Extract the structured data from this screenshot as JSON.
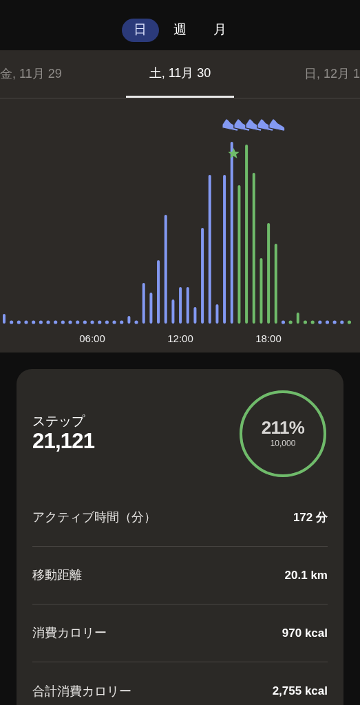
{
  "period_tabs": [
    {
      "label": "日",
      "selected": true
    },
    {
      "label": "週",
      "selected": false
    },
    {
      "label": "月",
      "selected": false
    }
  ],
  "date_tabs": [
    {
      "label": "金, 11月 29",
      "selected": false
    },
    {
      "label": "土, 11月 30",
      "selected": true
    },
    {
      "label": "日, 12月 1",
      "selected": false
    }
  ],
  "chart": {
    "x_labels": [
      "06:00",
      "12:00",
      "18:00"
    ]
  },
  "summary": {
    "title": "ステップ",
    "value": "21,121",
    "percent": "211%",
    "goal": "10,000",
    "level": 1
  },
  "stats": [
    {
      "label": "アクティブ時間（分）",
      "value": "172 分"
    },
    {
      "label": "移動距離",
      "value": "20.1 km"
    },
    {
      "label": "消費カロリー",
      "value": "970 kcal"
    },
    {
      "label": "合計消費カロリー",
      "value": "2,755 kcal"
    }
  ]
}
